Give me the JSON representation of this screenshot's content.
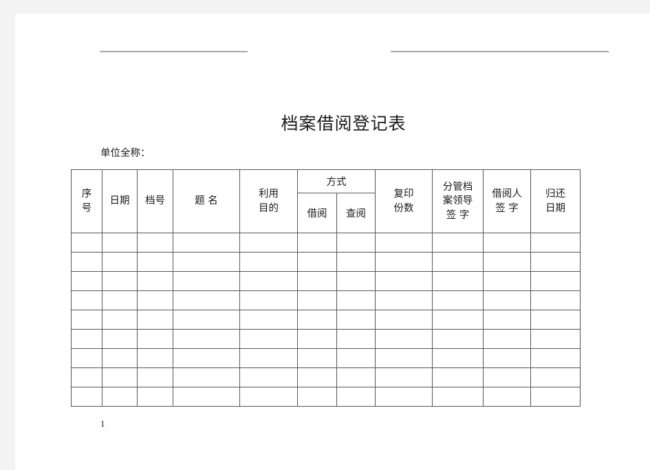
{
  "document": {
    "title": "档案借阅登记表",
    "unit_label": "单位全称：",
    "page_number": "1"
  },
  "colors": {
    "page_background": "#ffffff",
    "canvas_background": "#f4f4f4",
    "rule": "#a6a6a6",
    "table_border": "#555555",
    "text": "#1a1a1a"
  },
  "table": {
    "headers": {
      "seq": "序\n号",
      "seq_line1": "序",
      "seq_line2": "号",
      "date": "日期",
      "archive_no": "档号",
      "title": "题 名",
      "purpose_line1": "利用",
      "purpose_line2": "目的",
      "method_group": "方式",
      "method_borrow": "借阅",
      "method_read": "查阅",
      "copies_line1": "复印",
      "copies_line2": "份数",
      "leader_line1": "分管档",
      "leader_line2": "案领导",
      "leader_line3": "签  字",
      "borrower_line1": "借阅人",
      "borrower_line2": "签  字",
      "return_line1": "归还",
      "return_line2": "日期"
    },
    "column_count": 11,
    "body_row_count": 9,
    "body_rows": [
      [
        "",
        "",
        "",
        "",
        "",
        "",
        "",
        "",
        "",
        "",
        ""
      ],
      [
        "",
        "",
        "",
        "",
        "",
        "",
        "",
        "",
        "",
        "",
        ""
      ],
      [
        "",
        "",
        "",
        "",
        "",
        "",
        "",
        "",
        "",
        "",
        ""
      ],
      [
        "",
        "",
        "",
        "",
        "",
        "",
        "",
        "",
        "",
        "",
        ""
      ],
      [
        "",
        "",
        "",
        "",
        "",
        "",
        "",
        "",
        "",
        "",
        ""
      ],
      [
        "",
        "",
        "",
        "",
        "",
        "",
        "",
        "",
        "",
        "",
        ""
      ],
      [
        "",
        "",
        "",
        "",
        "",
        "",
        "",
        "",
        "",
        "",
        ""
      ],
      [
        "",
        "",
        "",
        "",
        "",
        "",
        "",
        "",
        "",
        "",
        ""
      ],
      [
        "",
        "",
        "",
        "",
        "",
        "",
        "",
        "",
        "",
        "",
        ""
      ]
    ]
  }
}
